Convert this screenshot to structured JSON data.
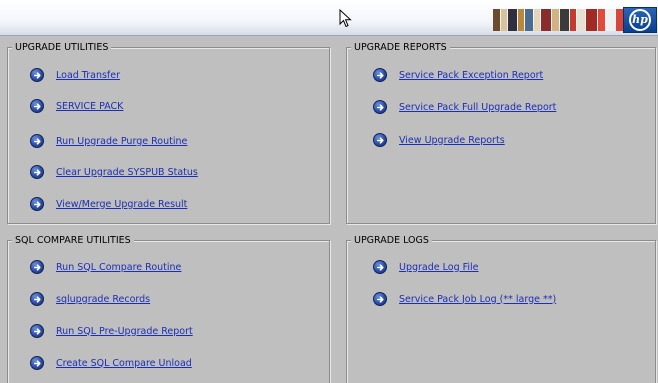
{
  "panels": {
    "upgrade_utilities": {
      "title": "UPGRADE UTILITIES",
      "links": [
        "Load Transfer",
        "SERVICE PACK",
        "Run Upgrade Purge Routine",
        "Clear Upgrade SYSPUB Status",
        "View/Merge Upgrade Result"
      ]
    },
    "upgrade_reports": {
      "title": "UPGRADE REPORTS",
      "links": [
        "Service Pack Exception Report",
        "Service Pack Full Upgrade Report",
        "View Upgrade Reports"
      ]
    },
    "sql_compare_utilities": {
      "title": "SQL COMPARE UTILITIES",
      "links": [
        "Run SQL Compare Routine",
        "sqlupgrade Records",
        "Run SQL Pre-Upgrade Report",
        "Create SQL Compare Unload"
      ]
    },
    "upgrade_logs": {
      "title": "UPGRADE LOGS",
      "links": [
        "Upgrade Log File",
        "Service Pack Job Log (** large **)"
      ]
    }
  },
  "header": {
    "logo_icon": "hp-logo-icon",
    "banner": "people-banner-image",
    "colors": {
      "link": "#1a2fb5",
      "panel_bg": "#bfbfbf",
      "arrow": "#2b4fa8"
    }
  }
}
